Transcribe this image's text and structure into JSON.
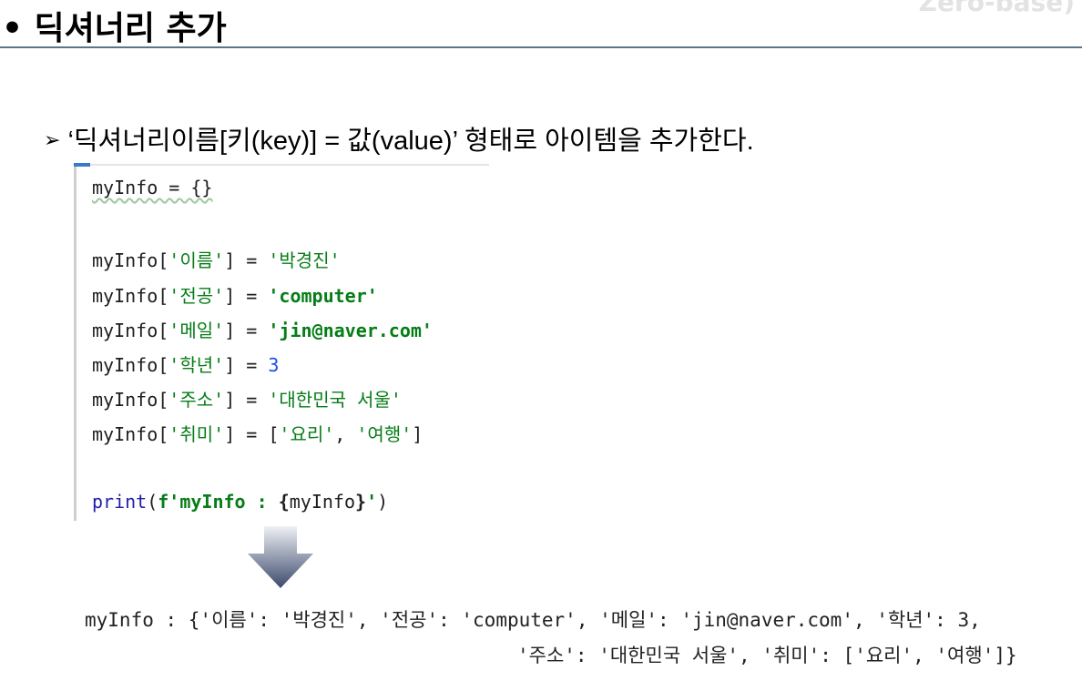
{
  "slide": {
    "title": "• 딕셔너리 추가",
    "watermark": "Zero-base)",
    "bullet_marker": "➢",
    "bullet_text": "‘딕셔너리이름[키(key)] = 값(value)’ 형태로 아이템을 추가한다."
  },
  "code": {
    "line1": "myInfo = {}",
    "assignments": [
      {
        "prefix": "myInfo[",
        "key": "'이름'",
        "mid": "] = ",
        "value": "'박경진'",
        "value_type": "string"
      },
      {
        "prefix": "myInfo[",
        "key": "'전공'",
        "mid": "] = ",
        "value": "'computer'",
        "value_type": "string-bold"
      },
      {
        "prefix": "myInfo[",
        "key": "'메일'",
        "mid": "] = ",
        "value": "'jin@naver.com'",
        "value_type": "string-bold"
      },
      {
        "prefix": "myInfo[",
        "key": "'학년'",
        "mid": "] = ",
        "value": "3",
        "value_type": "number"
      },
      {
        "prefix": "myInfo[",
        "key": "'주소'",
        "mid": "] = ",
        "value": "'대한민국 서울'",
        "value_type": "string"
      },
      {
        "prefix": "myInfo[",
        "key": "'취미'",
        "mid": "] = [",
        "value": "'요리'",
        "value_type": "string",
        "sep": ", ",
        "value2": "'여행'",
        "close": "]"
      }
    ],
    "print_fn": "print",
    "print_open": "(",
    "print_fstring_start": "f'myInfo : ",
    "print_brace_open": "{",
    "print_var": "myInfo",
    "print_brace_close": "}",
    "print_fstring_end": "'",
    "print_close": ")"
  },
  "output": {
    "line1": "myInfo : {'이름': '박경진', '전공': 'computer', '메일': 'jin@naver.com', '학년': 3,",
    "line2": "'주소': '대한민국 서울', '취미': ['요리', '여행']}"
  },
  "colors": {
    "string": "#067d17",
    "number": "#1750eb",
    "keyword_fn": "#1f1fa8",
    "title_rule": "#5a7489",
    "arrow_top": "#e6e9ef",
    "arrow_bottom": "#3b4a6b"
  }
}
